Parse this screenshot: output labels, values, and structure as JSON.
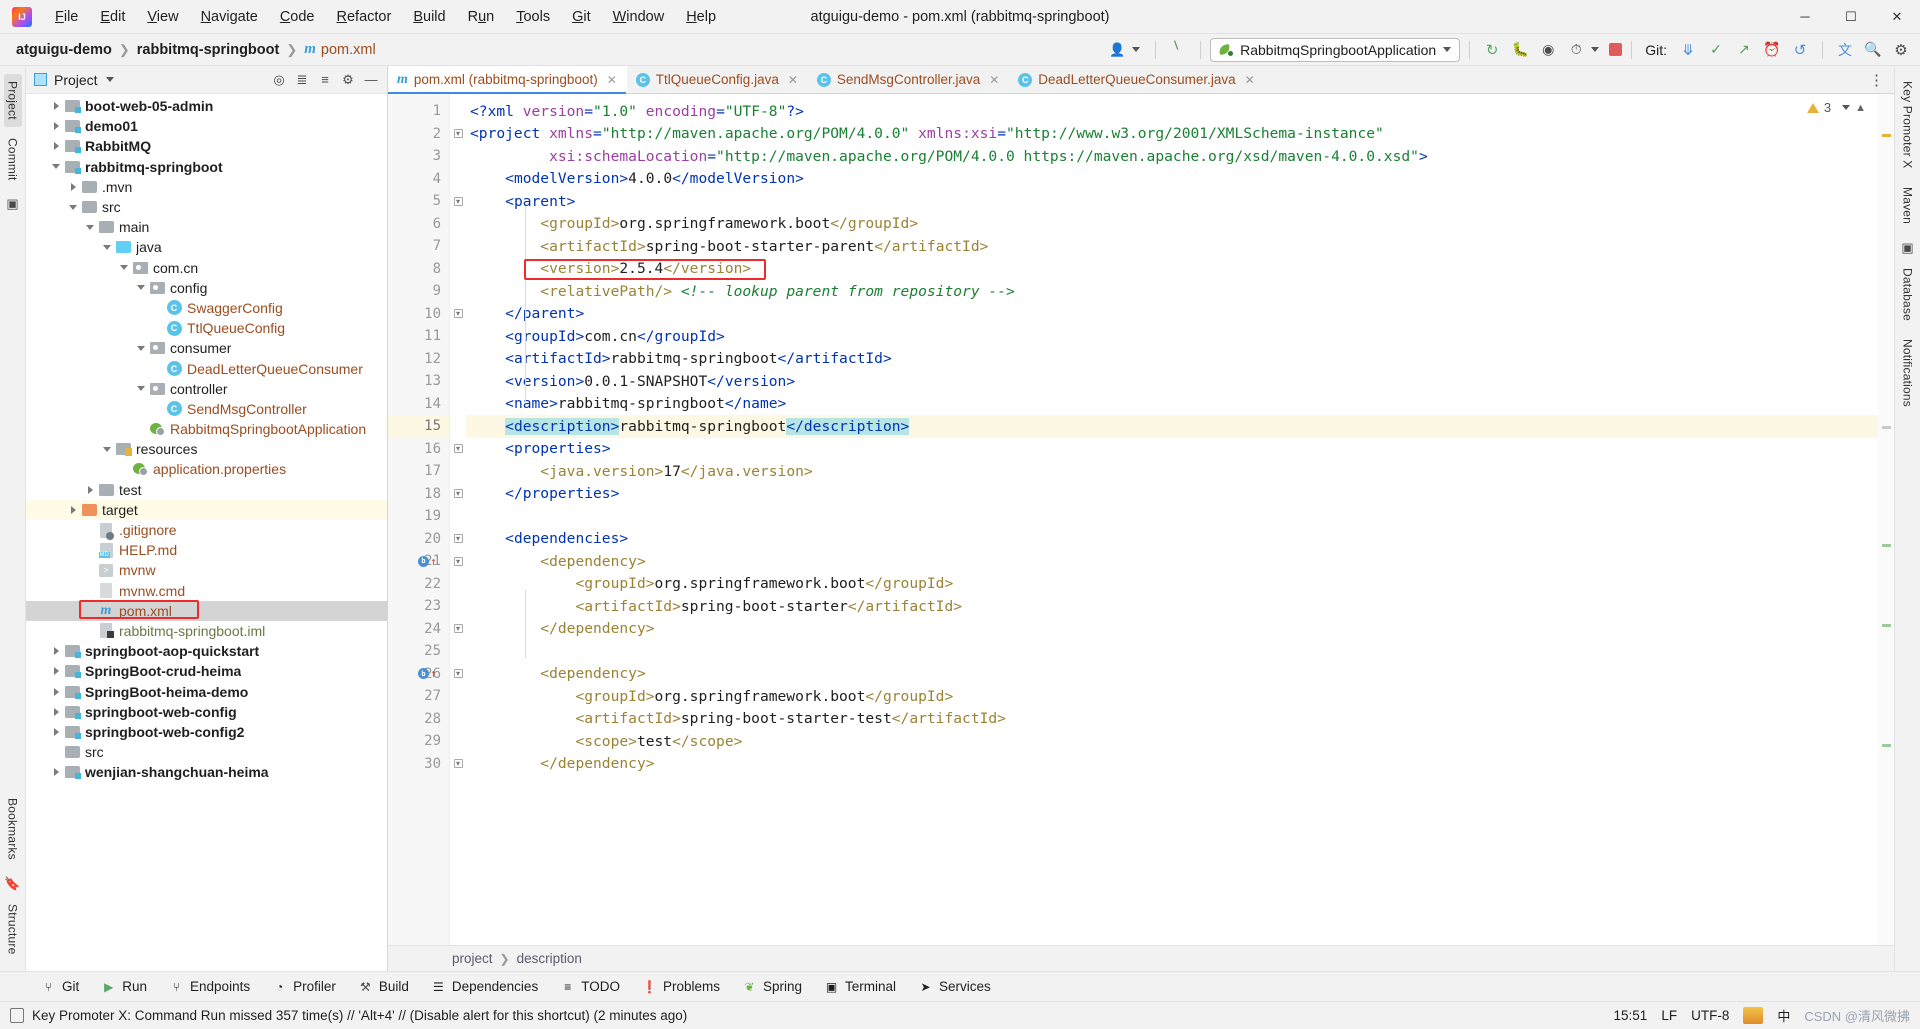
{
  "window": {
    "title": "atguigu-demo - pom.xml (rabbitmq-springboot)",
    "minimize": "─",
    "maximize": "❐",
    "close": "✕"
  },
  "menubar": [
    {
      "label": "File"
    },
    {
      "label": "Edit"
    },
    {
      "label": "View"
    },
    {
      "label": "Navigate"
    },
    {
      "label": "Code"
    },
    {
      "label": "Refactor"
    },
    {
      "label": "Build"
    },
    {
      "label": "Run"
    },
    {
      "label": "Tools"
    },
    {
      "label": "Git"
    },
    {
      "label": "Window"
    },
    {
      "label": "Help"
    }
  ],
  "navbar": {
    "crumbs": [
      "atguigu-demo",
      "rabbitmq-springboot"
    ],
    "file": "pom.xml",
    "run_config": "RabbitmqSpringbootApplication",
    "git_label": "Git:",
    "icons": {
      "user": "user-icon",
      "hammer": "build-hammer-icon",
      "rerun": "rerun-icon",
      "debug": "debug-bug-icon",
      "coverage": "run-with-coverage-icon",
      "profiler": "profiler-icon",
      "stop": "stop-icon",
      "git_update": "git-update-icon",
      "git_commit": "git-commit-icon",
      "git_push": "git-push-icon",
      "history": "history-icon",
      "undo": "undo-icon",
      "translate": "translate-icon",
      "search": "search-icon",
      "settings": "settings-gear-icon"
    }
  },
  "left_rail": [
    {
      "label": "Project",
      "selected": true
    },
    {
      "label": "Commit",
      "selected": false
    },
    {
      "label": "Bookmarks",
      "selected": false
    },
    {
      "label": "Structure",
      "selected": false
    }
  ],
  "right_rail": [
    {
      "label": "Key Promoter X"
    },
    {
      "label": "Maven"
    },
    {
      "label": "Database"
    },
    {
      "label": "Notifications"
    }
  ],
  "project_panel": {
    "title": "Project",
    "icons": [
      "locate-icon",
      "expand-all-icon",
      "collapse-all-icon",
      "settings-gear-icon",
      "hide-icon"
    ],
    "tree": [
      {
        "label": "boot-web-05-admin",
        "depth": 1,
        "arrow": "right",
        "icon": "module",
        "style": "bold"
      },
      {
        "label": "demo01",
        "depth": 1,
        "arrow": "right",
        "icon": "module",
        "style": "bold"
      },
      {
        "label": "RabbitMQ",
        "depth": 1,
        "arrow": "right",
        "icon": "module",
        "style": "bold"
      },
      {
        "label": "rabbitmq-springboot",
        "depth": 1,
        "arrow": "down",
        "icon": "module",
        "style": "bold"
      },
      {
        "label": ".mvn",
        "depth": 2,
        "arrow": "right",
        "icon": "folder",
        "style": "dark"
      },
      {
        "label": "src",
        "depth": 2,
        "arrow": "down",
        "icon": "folder",
        "style": "dark"
      },
      {
        "label": "main",
        "depth": 3,
        "arrow": "down",
        "icon": "folder",
        "style": "dark"
      },
      {
        "label": "java",
        "depth": 4,
        "arrow": "down",
        "icon": "source",
        "style": "dark"
      },
      {
        "label": "com.cn",
        "depth": 5,
        "arrow": "down",
        "icon": "package",
        "style": "dark"
      },
      {
        "label": "config",
        "depth": 6,
        "arrow": "down",
        "icon": "package",
        "style": "dark"
      },
      {
        "label": "SwaggerConfig",
        "depth": 7,
        "arrow": "none",
        "icon": "class",
        "style": "java"
      },
      {
        "label": "TtlQueueConfig",
        "depth": 7,
        "arrow": "none",
        "icon": "class",
        "style": "java"
      },
      {
        "label": "consumer",
        "depth": 6,
        "arrow": "down",
        "icon": "package",
        "style": "dark"
      },
      {
        "label": "DeadLetterQueueConsumer",
        "depth": 7,
        "arrow": "none",
        "icon": "class",
        "style": "java"
      },
      {
        "label": "controller",
        "depth": 6,
        "arrow": "down",
        "icon": "package",
        "style": "dark"
      },
      {
        "label": "SendMsgController",
        "depth": 7,
        "arrow": "none",
        "icon": "class",
        "style": "java"
      },
      {
        "label": "RabbitmqSpringbootApplication",
        "depth": 6,
        "arrow": "none",
        "icon": "spring",
        "style": "java"
      },
      {
        "label": "resources",
        "depth": 4,
        "arrow": "down",
        "icon": "resources",
        "style": "dark"
      },
      {
        "label": "application.properties",
        "depth": 5,
        "arrow": "none",
        "icon": "spring",
        "style": "java"
      },
      {
        "label": "test",
        "depth": 3,
        "arrow": "right",
        "icon": "folder",
        "style": "dark"
      },
      {
        "label": "target",
        "depth": 2,
        "arrow": "right",
        "icon": "target",
        "style": "dark",
        "highlight": "yellow"
      },
      {
        "label": ".gitignore",
        "depth": 3,
        "arrow": "none",
        "icon": "gitignore",
        "style": "file"
      },
      {
        "label": "HELP.md",
        "depth": 3,
        "arrow": "none",
        "icon": "md",
        "style": "file"
      },
      {
        "label": "mvnw",
        "depth": 3,
        "arrow": "none",
        "icon": "sh",
        "style": "file"
      },
      {
        "label": "mvnw.cmd",
        "depth": 3,
        "arrow": "none",
        "icon": "cmd",
        "style": "file"
      },
      {
        "label": "pom.xml",
        "depth": 3,
        "arrow": "none",
        "icon": "maven",
        "style": "file",
        "selected": true,
        "annotated": true
      },
      {
        "label": "rabbitmq-springboot.iml",
        "depth": 3,
        "arrow": "none",
        "icon": "iml",
        "style": "iml"
      },
      {
        "label": "springboot-aop-quickstart",
        "depth": 1,
        "arrow": "right",
        "icon": "module",
        "style": "bold"
      },
      {
        "label": "SpringBoot-crud-heima",
        "depth": 1,
        "arrow": "right",
        "icon": "module",
        "style": "bold"
      },
      {
        "label": "SpringBoot-heima-demo",
        "depth": 1,
        "arrow": "right",
        "icon": "module",
        "style": "bold"
      },
      {
        "label": "springboot-web-config",
        "depth": 1,
        "arrow": "right",
        "icon": "module",
        "style": "bold"
      },
      {
        "label": "springboot-web-config2",
        "depth": 1,
        "arrow": "right",
        "icon": "module",
        "style": "bold"
      },
      {
        "label": "src",
        "depth": 1,
        "arrow": "none",
        "icon": "folder",
        "style": "dark"
      },
      {
        "label": "wenjian-shangchuan-heima",
        "depth": 1,
        "arrow": "right",
        "icon": "module",
        "style": "bold"
      }
    ]
  },
  "editor_tabs": [
    {
      "label": "pom.xml (rabbitmq-springboot)",
      "icon": "maven",
      "active": true
    },
    {
      "label": "TtlQueueConfig.java",
      "icon": "class",
      "active": false
    },
    {
      "label": "SendMsgController.java",
      "icon": "class",
      "active": false
    },
    {
      "label": "DeadLetterQueueConsumer.java",
      "icon": "class",
      "active": false
    }
  ],
  "editor": {
    "inspection_count": "3",
    "current_line": 15,
    "gutter_marks": [
      {
        "line": 21,
        "type": "bean"
      },
      {
        "line": 26,
        "type": "bean"
      }
    ],
    "fold_lines": [
      2,
      5,
      10,
      16,
      18,
      20,
      21,
      24,
      26,
      30
    ],
    "lines": [
      {
        "n": 1,
        "tokens": [
          {
            "t": "tag",
            "v": "<?xml "
          },
          {
            "t": "attr",
            "v": "version"
          },
          {
            "t": "tag",
            "v": "="
          },
          {
            "t": "str",
            "v": "\"1.0\""
          },
          {
            "t": "txt",
            "v": " "
          },
          {
            "t": "attr",
            "v": "encoding"
          },
          {
            "t": "tag",
            "v": "="
          },
          {
            "t": "str",
            "v": "\"UTF-8\""
          },
          {
            "t": "tag",
            "v": "?>"
          }
        ]
      },
      {
        "n": 2,
        "tokens": [
          {
            "t": "tag",
            "v": "<project "
          },
          {
            "t": "attr",
            "v": "xmlns"
          },
          {
            "t": "tag",
            "v": "="
          },
          {
            "t": "str",
            "v": "\"http://maven.apache.org/POM/4.0.0\""
          },
          {
            "t": "txt",
            "v": " "
          },
          {
            "t": "attr",
            "v": "xmlns:xsi"
          },
          {
            "t": "tag",
            "v": "="
          },
          {
            "t": "str",
            "v": "\"http://www.w3.org/2001/XMLSchema-instance\""
          }
        ]
      },
      {
        "n": 3,
        "tokens": [
          {
            "t": "txt",
            "v": "         "
          },
          {
            "t": "attr",
            "v": "xsi:schemaLocation"
          },
          {
            "t": "tag",
            "v": "="
          },
          {
            "t": "str",
            "v": "\"http://maven.apache.org/POM/4.0.0 https://maven.apache.org/xsd/maven-4.0.0.xsd\""
          },
          {
            "t": "tag",
            "v": ">"
          }
        ]
      },
      {
        "n": 4,
        "tokens": [
          {
            "t": "txt",
            "v": "    "
          },
          {
            "t": "tag",
            "v": "<modelVersion>"
          },
          {
            "t": "txt",
            "v": "4.0.0"
          },
          {
            "t": "tag",
            "v": "</modelVersion>"
          }
        ]
      },
      {
        "n": 5,
        "tokens": [
          {
            "t": "txt",
            "v": "    "
          },
          {
            "t": "tag",
            "v": "<parent>"
          }
        ]
      },
      {
        "n": 6,
        "tokens": [
          {
            "t": "txt",
            "v": "        "
          },
          {
            "t": "tag2",
            "v": "<groupId>"
          },
          {
            "t": "txt",
            "v": "org.springframework.boot"
          },
          {
            "t": "tag2",
            "v": "</groupId>"
          }
        ]
      },
      {
        "n": 7,
        "tokens": [
          {
            "t": "txt",
            "v": "        "
          },
          {
            "t": "tag2",
            "v": "<artifactId>"
          },
          {
            "t": "txt",
            "v": "spring-boot-starter-parent"
          },
          {
            "t": "tag2",
            "v": "</artifactId>"
          }
        ]
      },
      {
        "n": 8,
        "tokens": [
          {
            "t": "txt",
            "v": "        "
          },
          {
            "t": "tag2",
            "v": "<version>"
          },
          {
            "t": "txt",
            "v": "2.5.4"
          },
          {
            "t": "tag2",
            "v": "</version>"
          }
        ],
        "annotated": true
      },
      {
        "n": 9,
        "tokens": [
          {
            "t": "txt",
            "v": "        "
          },
          {
            "t": "tag2",
            "v": "<relativePath/>"
          },
          {
            "t": "txt",
            "v": " "
          },
          {
            "t": "cmt",
            "v": "<!-- lookup parent from repository -->"
          }
        ]
      },
      {
        "n": 10,
        "tokens": [
          {
            "t": "txt",
            "v": "    "
          },
          {
            "t": "tag",
            "v": "</parent>"
          }
        ]
      },
      {
        "n": 11,
        "tokens": [
          {
            "t": "txt",
            "v": "    "
          },
          {
            "t": "tag",
            "v": "<groupId>"
          },
          {
            "t": "txt",
            "v": "com.cn"
          },
          {
            "t": "tag",
            "v": "</groupId>"
          }
        ]
      },
      {
        "n": 12,
        "tokens": [
          {
            "t": "txt",
            "v": "    "
          },
          {
            "t": "tag",
            "v": "<artifactId>"
          },
          {
            "t": "txt",
            "v": "rabbitmq-springboot"
          },
          {
            "t": "tag",
            "v": "</artifactId>"
          }
        ]
      },
      {
        "n": 13,
        "tokens": [
          {
            "t": "txt",
            "v": "    "
          },
          {
            "t": "tag",
            "v": "<version>"
          },
          {
            "t": "txt",
            "v": "0.0.1-SNAPSHOT"
          },
          {
            "t": "tag",
            "v": "</version>"
          }
        ]
      },
      {
        "n": 14,
        "tokens": [
          {
            "t": "txt",
            "v": "    "
          },
          {
            "t": "tag",
            "v": "<name>"
          },
          {
            "t": "txt",
            "v": "rabbitmq-springboot"
          },
          {
            "t": "tag",
            "v": "</name>"
          }
        ]
      },
      {
        "n": 15,
        "tokens": [
          {
            "t": "txt",
            "v": "    "
          },
          {
            "t": "tag hl",
            "v": "<description>"
          },
          {
            "t": "txt",
            "v": "rabbitmq-springboot"
          },
          {
            "t": "tag hl",
            "v": "</description>"
          }
        ],
        "current": true
      },
      {
        "n": 16,
        "tokens": [
          {
            "t": "txt",
            "v": "    "
          },
          {
            "t": "tag",
            "v": "<properties>"
          }
        ]
      },
      {
        "n": 17,
        "tokens": [
          {
            "t": "txt",
            "v": "        "
          },
          {
            "t": "tag2",
            "v": "<java.version>"
          },
          {
            "t": "txt",
            "v": "17"
          },
          {
            "t": "tag2",
            "v": "</java.version>"
          }
        ]
      },
      {
        "n": 18,
        "tokens": [
          {
            "t": "txt",
            "v": "    "
          },
          {
            "t": "tag",
            "v": "</properties>"
          }
        ]
      },
      {
        "n": 19,
        "tokens": []
      },
      {
        "n": 20,
        "tokens": [
          {
            "t": "txt",
            "v": "    "
          },
          {
            "t": "tag",
            "v": "<dependencies>"
          }
        ]
      },
      {
        "n": 21,
        "tokens": [
          {
            "t": "txt",
            "v": "        "
          },
          {
            "t": "tag2",
            "v": "<dependency>"
          }
        ]
      },
      {
        "n": 22,
        "tokens": [
          {
            "t": "txt",
            "v": "            "
          },
          {
            "t": "tag2",
            "v": "<groupId>"
          },
          {
            "t": "txt",
            "v": "org.springframework.boot"
          },
          {
            "t": "tag2",
            "v": "</groupId>"
          }
        ]
      },
      {
        "n": 23,
        "tokens": [
          {
            "t": "txt",
            "v": "            "
          },
          {
            "t": "tag2",
            "v": "<artifactId>"
          },
          {
            "t": "txt",
            "v": "spring-boot-starter"
          },
          {
            "t": "tag2",
            "v": "</artifactId>"
          }
        ]
      },
      {
        "n": 24,
        "tokens": [
          {
            "t": "txt",
            "v": "        "
          },
          {
            "t": "tag2",
            "v": "</dependency>"
          }
        ]
      },
      {
        "n": 25,
        "tokens": []
      },
      {
        "n": 26,
        "tokens": [
          {
            "t": "txt",
            "v": "        "
          },
          {
            "t": "tag2",
            "v": "<dependency>"
          }
        ]
      },
      {
        "n": 27,
        "tokens": [
          {
            "t": "txt",
            "v": "            "
          },
          {
            "t": "tag2",
            "v": "<groupId>"
          },
          {
            "t": "txt",
            "v": "org.springframework.boot"
          },
          {
            "t": "tag2",
            "v": "</groupId>"
          }
        ]
      },
      {
        "n": 28,
        "tokens": [
          {
            "t": "txt",
            "v": "            "
          },
          {
            "t": "tag2",
            "v": "<artifactId>"
          },
          {
            "t": "txt",
            "v": "spring-boot-starter-test"
          },
          {
            "t": "tag2",
            "v": "</artifactId>"
          }
        ]
      },
      {
        "n": 29,
        "tokens": [
          {
            "t": "txt",
            "v": "            "
          },
          {
            "t": "tag2",
            "v": "<scope>"
          },
          {
            "t": "txt",
            "v": "test"
          },
          {
            "t": "tag2",
            "v": "</scope>"
          }
        ]
      },
      {
        "n": 30,
        "tokens": [
          {
            "t": "txt",
            "v": "        "
          },
          {
            "t": "tag2",
            "v": "</dependency>"
          }
        ]
      }
    ],
    "breadcrumb": [
      "project",
      "description"
    ]
  },
  "tool_window_bar": [
    {
      "label": "Git",
      "icon": "git-branch-icon"
    },
    {
      "label": "Run",
      "icon": "run-play-icon"
    },
    {
      "label": "Endpoints",
      "icon": "endpoints-icon"
    },
    {
      "label": "Profiler",
      "icon": "profiler-icon"
    },
    {
      "label": "Build",
      "icon": "build-hammer-icon"
    },
    {
      "label": "Dependencies",
      "icon": "dependencies-icon"
    },
    {
      "label": "TODO",
      "icon": "todo-list-icon"
    },
    {
      "label": "Problems",
      "icon": "problems-icon"
    },
    {
      "label": "Spring",
      "icon": "spring-leaf-icon"
    },
    {
      "label": "Terminal",
      "icon": "terminal-icon"
    },
    {
      "label": "Services",
      "icon": "services-icon"
    }
  ],
  "statusbar": {
    "message": "Key Promoter X: Command Run missed 357 time(s) // 'Alt+4' // (Disable alert for this shortcut) (2 minutes ago)",
    "time": "15:51",
    "line_separator": "LF",
    "encoding": "UTF-8",
    "ime_label": "中",
    "watermark": "CSDN @清风微拂"
  },
  "colors": {
    "accent": "#3c8ce7",
    "annotation_red": "#ef2a2a",
    "spring_green": "#6db33f",
    "xml_tag": "#0033b3",
    "xml_tag_inner": "#9b8334",
    "xml_string": "#1a8033",
    "xml_comment": "#1a8033",
    "java_file": "#9b4d20"
  }
}
